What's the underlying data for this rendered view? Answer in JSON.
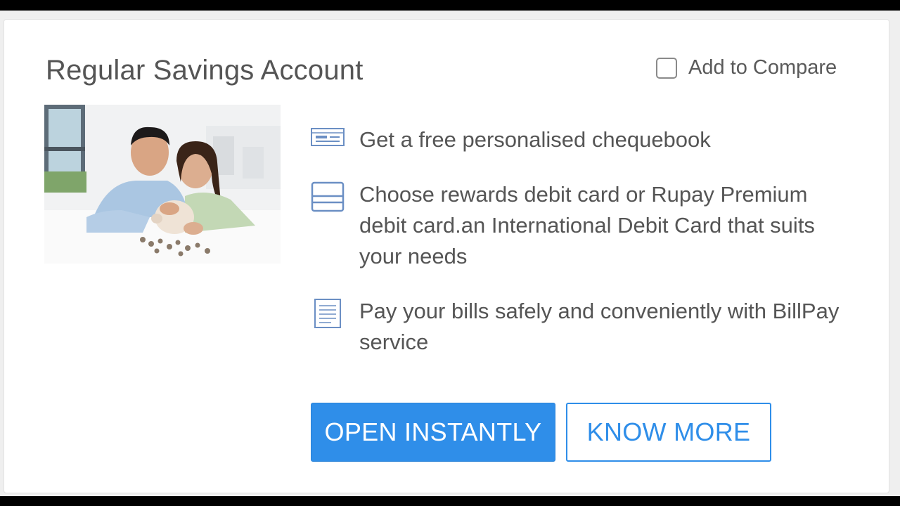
{
  "card": {
    "title": "Regular Savings Account",
    "compare_label": "Add to Compare",
    "compare_checked": false,
    "image_alt": "Couple smiling with a piggy bank and coins",
    "features": [
      {
        "icon": "cheque-icon",
        "text": "Get a free personalised chequebook"
      },
      {
        "icon": "debit-card-icon",
        "text": "Choose rewards debit card or Rupay Premium debit card.an International Debit Card that suits your needs"
      },
      {
        "icon": "bill-document-icon",
        "text": "Pay your bills safely and conveniently with BillPay service"
      }
    ],
    "buttons": {
      "primary": "OPEN INSTANTLY",
      "secondary": "KNOW MORE"
    }
  },
  "colors": {
    "accent": "#2f8ee9",
    "text": "#555555",
    "icon": "#6b8fc4"
  }
}
